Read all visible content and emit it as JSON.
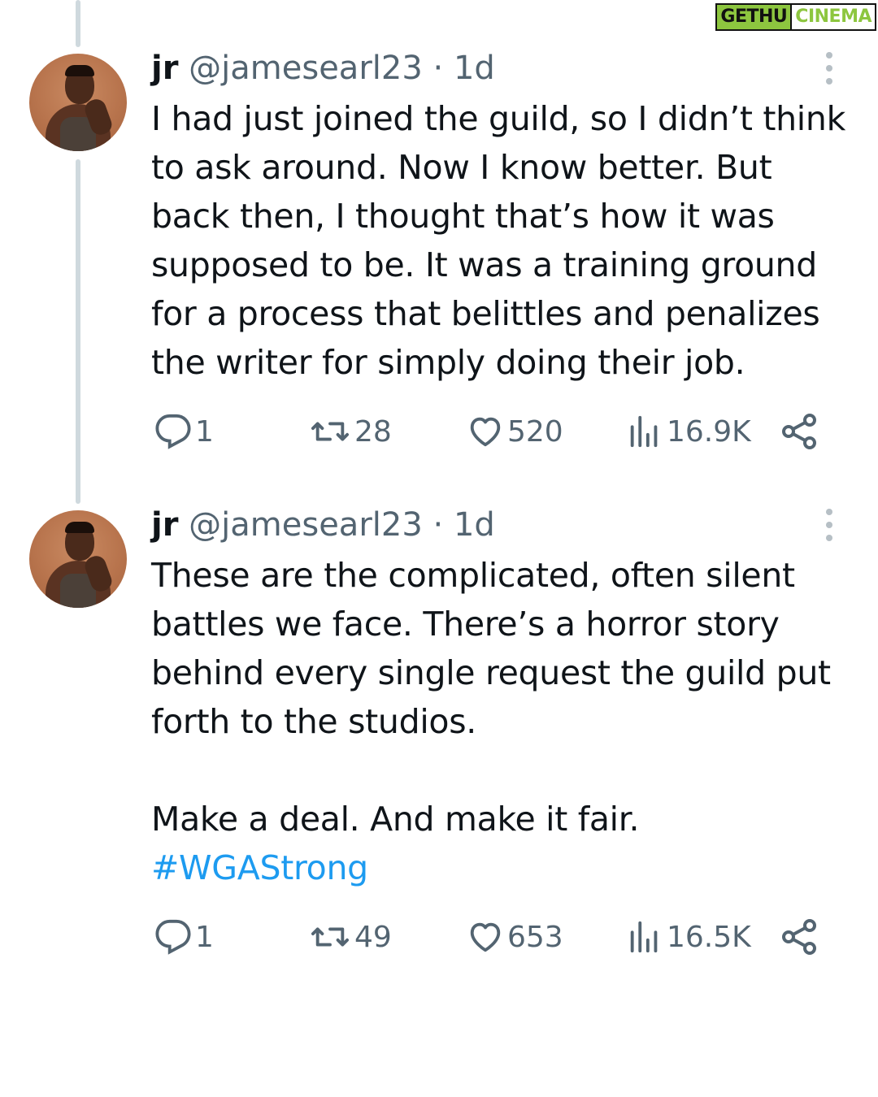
{
  "watermark": {
    "left": "GETHU",
    "right": "CINEMA"
  },
  "tweets": [
    {
      "name": "jr",
      "handle": "@jamesearl23",
      "separator": "·",
      "time": "1d",
      "lines": [
        "I had just joined the guild, so I didn’t think",
        "to ask around. Now I know better. But",
        "back then, I thought that’s how it was",
        "supposed to be. It was a training ground",
        "for a process that belittles and penalizes",
        "the writer for simply doing their job."
      ],
      "replies": "1",
      "retweets": "28",
      "likes": "520",
      "views": "16.9K"
    },
    {
      "name": "jr",
      "handle": "@jamesearl23",
      "separator": "·",
      "time": "1d",
      "lines": [
        "These are the complicated, often silent",
        "battles we face. There’s a horror story",
        "behind every single request the guild put",
        "forth to the studios."
      ],
      "closing": "Make a deal. And make it fair.",
      "hashtag": "#WGAStrong",
      "replies": "1",
      "retweets": "49",
      "likes": "653",
      "views": "16.5K"
    }
  ],
  "icons": {
    "reply": "reply-bubble-icon",
    "retweet": "retweet-icon",
    "like": "heart-icon",
    "views": "views-bar-chart-icon",
    "share": "share-icon",
    "more": "more-vertical-icon"
  },
  "colors": {
    "text": "#0f1419",
    "secondary": "#536471",
    "link": "#1d9bf0",
    "thread_line": "#cfd9de",
    "watermark_green": "#8dc63f"
  }
}
